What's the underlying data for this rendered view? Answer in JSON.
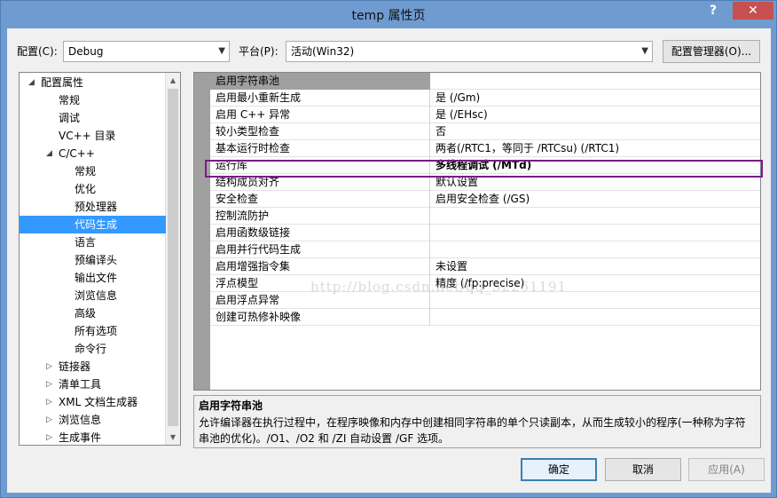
{
  "window": {
    "title": "temp 属性页",
    "help_label": "?",
    "close_label": "✕"
  },
  "config": {
    "label": "配置(C):",
    "value": "Debug",
    "platform_label": "平台(P):",
    "platform_value": "活动(Win32)",
    "manager_label": "配置管理器(O)..."
  },
  "tree": {
    "items": [
      {
        "label": "配置属性",
        "level": 0,
        "expander": "◢"
      },
      {
        "label": "常规",
        "level": 1,
        "expander": ""
      },
      {
        "label": "调试",
        "level": 1,
        "expander": ""
      },
      {
        "label": "VC++ 目录",
        "level": 1,
        "expander": ""
      },
      {
        "label": "C/C++",
        "level": 1,
        "expander": "◢"
      },
      {
        "label": "常规",
        "level": 2,
        "expander": ""
      },
      {
        "label": "优化",
        "level": 2,
        "expander": ""
      },
      {
        "label": "预处理器",
        "level": 2,
        "expander": ""
      },
      {
        "label": "代码生成",
        "level": 2,
        "expander": "",
        "selected": true
      },
      {
        "label": "语言",
        "level": 2,
        "expander": ""
      },
      {
        "label": "预编译头",
        "level": 2,
        "expander": ""
      },
      {
        "label": "输出文件",
        "level": 2,
        "expander": ""
      },
      {
        "label": "浏览信息",
        "level": 2,
        "expander": ""
      },
      {
        "label": "高级",
        "level": 2,
        "expander": ""
      },
      {
        "label": "所有选项",
        "level": 2,
        "expander": ""
      },
      {
        "label": "命令行",
        "level": 2,
        "expander": ""
      },
      {
        "label": "链接器",
        "level": 1,
        "expander": "▷"
      },
      {
        "label": "清单工具",
        "level": 1,
        "expander": "▷"
      },
      {
        "label": "XML 文档生成器",
        "level": 1,
        "expander": "▷"
      },
      {
        "label": "浏览信息",
        "level": 1,
        "expander": "▷"
      },
      {
        "label": "生成事件",
        "level": 1,
        "expander": "▷"
      }
    ]
  },
  "grid": {
    "rows": [
      {
        "name": "启用字符串池",
        "value": "",
        "category": true
      },
      {
        "name": "启用最小重新生成",
        "value": "是 (/Gm)"
      },
      {
        "name": "启用 C++ 异常",
        "value": "是 (/EHsc)"
      },
      {
        "name": "较小类型检查",
        "value": "否"
      },
      {
        "name": "基本运行时检查",
        "value": "两者(/RTC1，等同于 /RTCsu) (/RTC1)"
      },
      {
        "name": "运行库",
        "value": "多线程调试 (/MTd)",
        "bold": true
      },
      {
        "name": "结构成员对齐",
        "value": "默认设置"
      },
      {
        "name": "安全检查",
        "value": "启用安全检查 (/GS)"
      },
      {
        "name": "控制流防护",
        "value": ""
      },
      {
        "name": "启用函数级链接",
        "value": ""
      },
      {
        "name": "启用并行代码生成",
        "value": ""
      },
      {
        "name": "启用增强指令集",
        "value": "未设置"
      },
      {
        "name": "浮点模型",
        "value": "精度 (/fp:precise)"
      },
      {
        "name": "启用浮点异常",
        "value": ""
      },
      {
        "name": "创建可热修补映像",
        "value": ""
      }
    ]
  },
  "watermark": "http://blog.csdn.net/qq_32261191",
  "description": {
    "title": "启用字符串池",
    "text": "允许编译器在执行过程中，在程序映像和内存中创建相同字符串的单个只读副本，从而生成较小的程序(一种称为字符串池的优化)。/O1、/O2 和 /ZI 自动设置 /GF 选项。"
  },
  "buttons": {
    "ok": "确定",
    "cancel": "取消",
    "apply": "应用(A)"
  },
  "colors": {
    "selection": "#3399ff",
    "highlight_box": "#7d1a86",
    "title_bar": "#6f9bd1",
    "close_button": "#c75050"
  }
}
